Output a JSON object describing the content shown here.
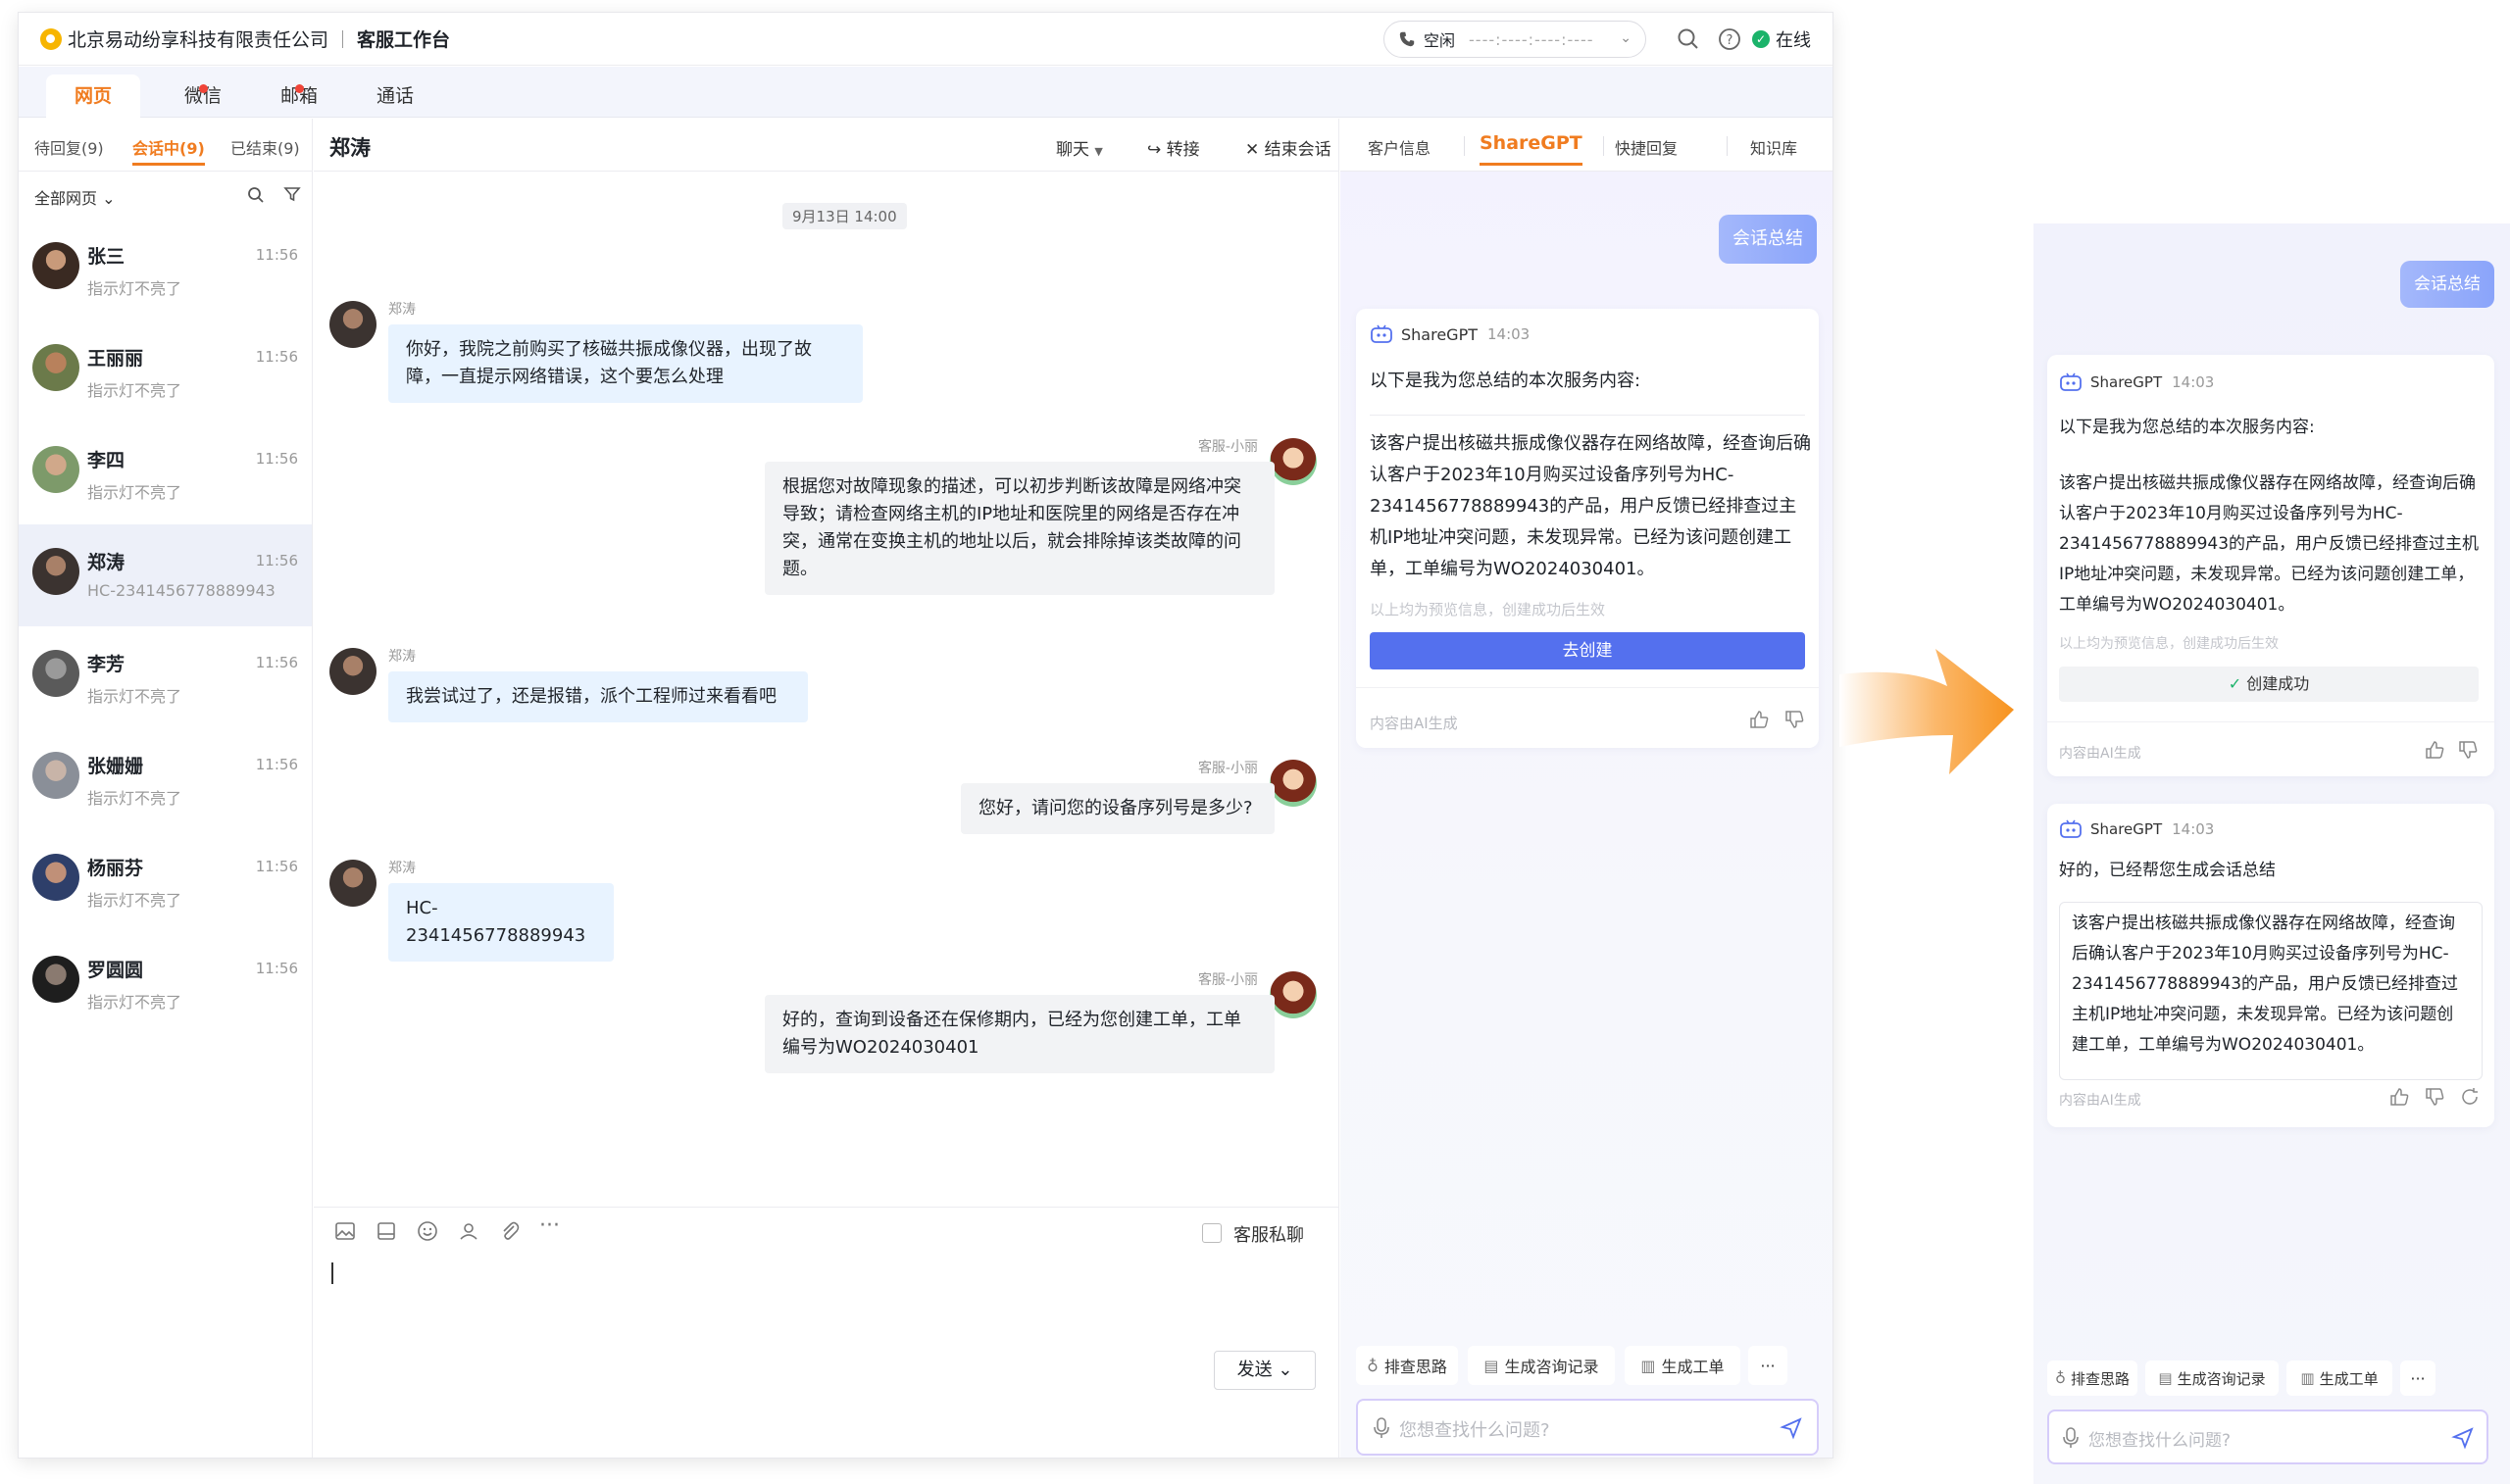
{
  "header": {
    "company": "北京易动纷享科技有限责任公司",
    "workbench": "客服工作台",
    "status_label": "空闲",
    "status_value": "----:----:----:----",
    "online_label": "在线"
  },
  "channel_tabs": [
    "网页",
    "微信",
    "邮箱",
    "通话"
  ],
  "session_tabs": [
    "待回复(9)",
    "会话中(9)",
    "已结束(9)"
  ],
  "filter_label": "全部网页",
  "conversations": [
    {
      "name": "张三",
      "time": "11:56",
      "preview": "指示灯不亮了"
    },
    {
      "name": "王丽丽",
      "time": "11:56",
      "preview": "指示灯不亮了"
    },
    {
      "name": "李四",
      "time": "11:56",
      "preview": "指示灯不亮了"
    },
    {
      "name": "郑涛",
      "time": "11:56",
      "preview": "HC-2341456778889943"
    },
    {
      "name": "李芳",
      "time": "11:56",
      "preview": "指示灯不亮了"
    },
    {
      "name": "张姗姗",
      "time": "11:56",
      "preview": "指示灯不亮了"
    },
    {
      "name": "杨丽芬",
      "time": "11:56",
      "preview": "指示灯不亮了"
    },
    {
      "name": "罗圆圆",
      "time": "11:56",
      "preview": "指示灯不亮了"
    }
  ],
  "chat": {
    "title": "郑涛",
    "actions": [
      "聊天",
      "转接",
      "结束会话"
    ],
    "date": "9月13日 14:00",
    "customer_name": "郑涛",
    "agent_name": "客服-小丽",
    "messages": [
      {
        "from": "customer",
        "text": "你好，我院之前购买了核磁共振成像仪器，出现了故障，一直提示网络错误，这个要怎么处理"
      },
      {
        "from": "agent",
        "text": "根据您对故障现象的描述，可以初步判断该故障是网络冲突导致；请检查网络主机的IP地址和医院里的网络是否存在冲突，通常在变换主机的地址以后，就会排除掉该类故障的问题。"
      },
      {
        "from": "customer",
        "text": "我尝试过了，还是报错，派个工程师过来看看吧"
      },
      {
        "from": "agent",
        "text": "您好，请问您的设备序列号是多少?"
      },
      {
        "from": "customer",
        "text": "HC-2341456778889943"
      },
      {
        "from": "agent",
        "text": "好的，查询到设备还在保修期内，已经为您创建工单，工单编号为WO2024030401"
      }
    ],
    "private_chat_label": "客服私聊",
    "send_label": "发送"
  },
  "assistant": {
    "tabs": [
      "客户信息",
      "ShareGPT",
      "快捷回复",
      "知识库"
    ],
    "user_request": "会话总结",
    "bot_name": "ShareGPT",
    "bot_time": "14:03",
    "intro": "以下是我为您总结的本次服务内容:",
    "summary": "该客户提出核磁共振成像仪器存在网络故障，经查询后确认客户于2023年10月购买过设备序列号为HC-2341456778889943的产品，用户反馈已经排查过主机IP地址冲突问题，未发现异常。已经为该问题创建工单，工单编号为WO2024030401。",
    "preview_hint": "以上均为预览信息，创建成功后生效",
    "create_button": "去创建",
    "create_success": "创建成功",
    "ai_footer": "内容由AI生成",
    "followup": "好的，已经帮您生成会话总结",
    "quick_chips": [
      "排查思路",
      "生成咨询记录",
      "生成工单"
    ],
    "input_placeholder": "您想查找什么问题?"
  },
  "colors": {
    "accent": "#f07c20",
    "primary": "#5470ee",
    "success": "#1bb36a"
  }
}
